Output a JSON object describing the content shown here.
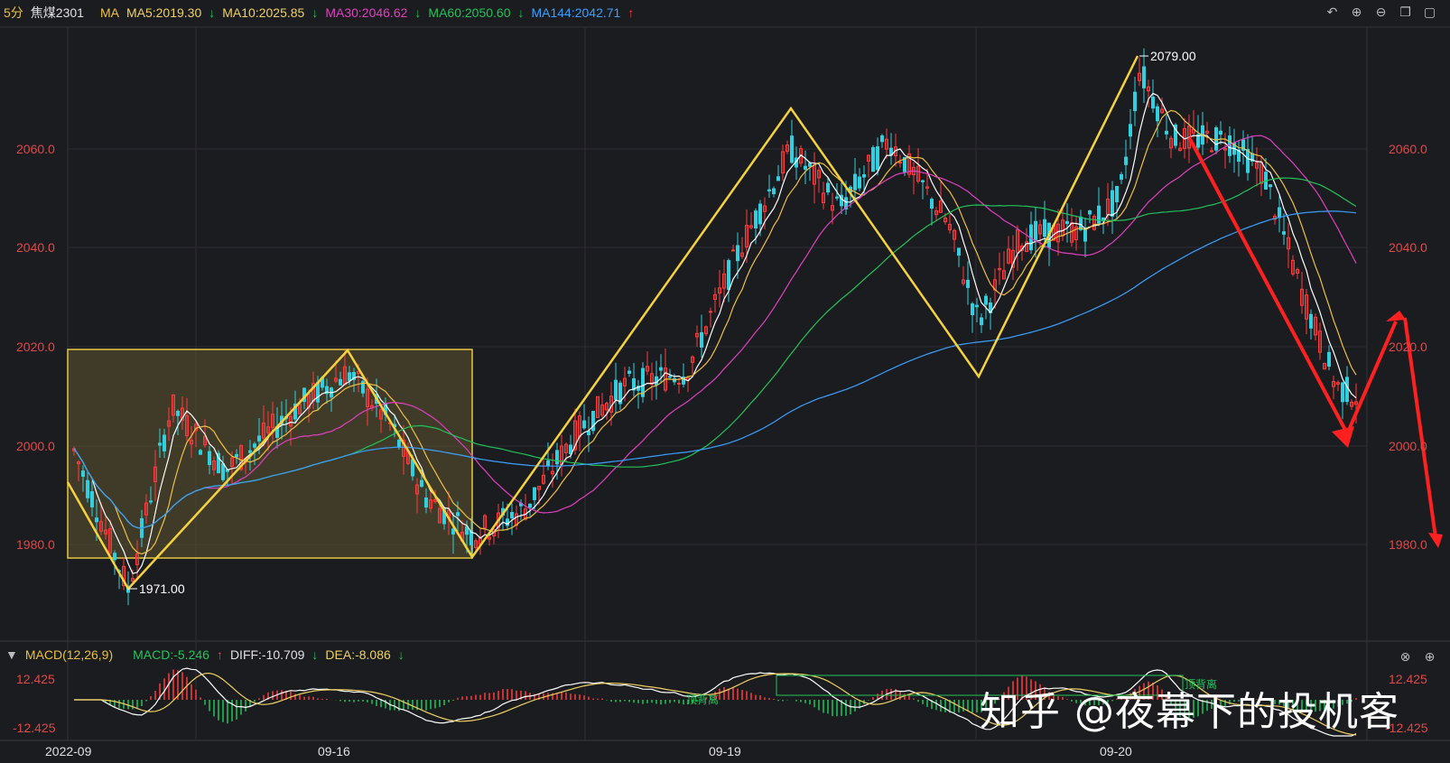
{
  "header": {
    "period": "5分",
    "symbol": "焦煤2301",
    "ma_title": "MA",
    "ma5": "MA5:2019.30",
    "ma10": "MA10:2025.85",
    "ma30": "MA30:2046.62",
    "ma60": "MA60:2050.60",
    "ma144": "MA144:2042.71",
    "ma_colors": {
      "ma5": "#f0c040",
      "ma10": "#f0d060",
      "ma30": "#e040c0",
      "ma60": "#21c35a",
      "ma144": "#3aa0ff"
    }
  },
  "toolbar_icons": [
    "undo-icon",
    "zoom-in-icon",
    "zoom-out-icon",
    "window-icon",
    "more-icon"
  ],
  "price_axis": {
    "ticks": [
      "2060.0",
      "2040.0",
      "2020.0",
      "2000.0",
      "1980.0"
    ],
    "values": [
      2060,
      2040,
      2020,
      2000,
      1980
    ]
  },
  "price_labels": {
    "high": "2079.00",
    "low": "1971.00"
  },
  "macd": {
    "title": "MACD(12,26,9)",
    "macd": "MACD:-5.246",
    "diff": "DIFF:-10.709",
    "dea": "DEA:-8.086",
    "axis_top": "12.425",
    "axis_bottom": "-12.425",
    "annotation": "顶背离"
  },
  "x_axis": [
    "2022-09",
    "09-16",
    "09-19",
    "09-20"
  ],
  "watermark": "知乎 @夜幕下的投机客",
  "colors": {
    "up": "#ff3b3b",
    "down": "#30d0e0",
    "pattern": "#f5d23c",
    "box": "#7a7040",
    "arrow": "#ff2020"
  }
}
